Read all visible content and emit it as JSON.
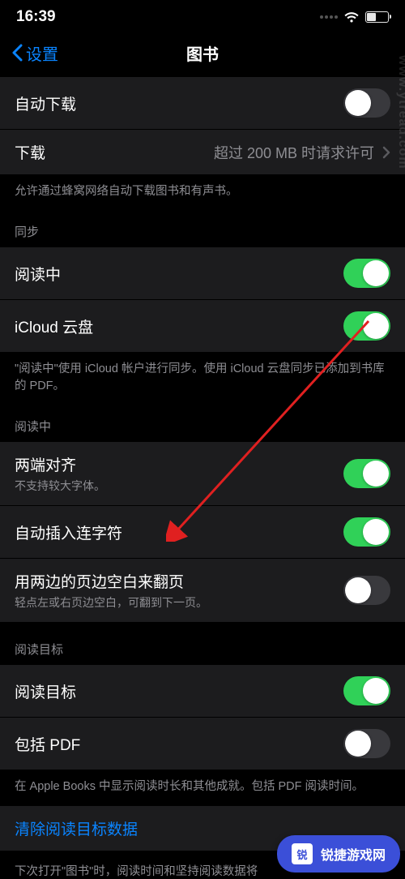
{
  "status": {
    "time": "16:39"
  },
  "nav": {
    "back": "设置",
    "title": "图书"
  },
  "section_download": {
    "auto_download": "自动下载",
    "download_label": "下载",
    "download_value": "超过 200 MB 时请求许可",
    "footer": "允许通过蜂窝网络自动下载图书和有声书。"
  },
  "section_sync": {
    "header": "同步",
    "reading_now": "阅读中",
    "icloud": "iCloud 云盘",
    "footer": "\"阅读中\"使用 iCloud 帐户进行同步。使用 iCloud 云盘同步已添加到书库的 PDF。"
  },
  "section_reading": {
    "header": "阅读中",
    "justify": "两端对齐",
    "justify_sub": "不支持较大字体。",
    "hyphenation": "自动插入连字符",
    "margin_tap": "用两边的页边空白来翻页",
    "margin_tap_sub": "轻点左或右页边空白，可翻到下一页。"
  },
  "section_goals": {
    "header": "阅读目标",
    "goals": "阅读目标",
    "include_pdf": "包括 PDF",
    "footer": "在 Apple Books 中显示阅读时长和其他成就。包括 PDF 阅读时间。",
    "clear": "清除阅读目标数据",
    "clear_footer": "下次打开\"图书\"时，阅读时间和坚持阅读数据将"
  },
  "watermark": "www.ytread.com",
  "badge": "锐捷游戏网"
}
